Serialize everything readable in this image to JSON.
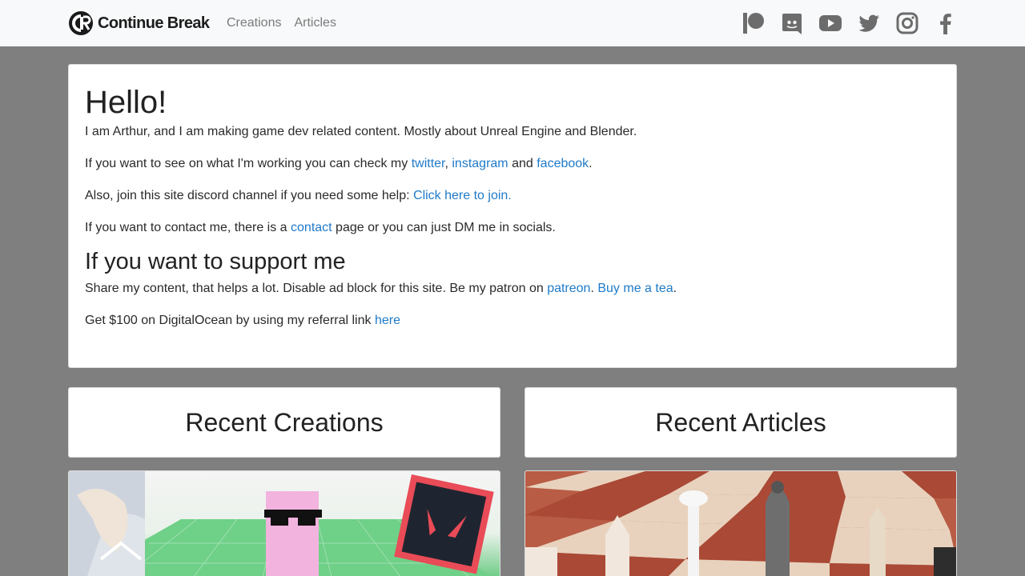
{
  "nav": {
    "brand": "Continue Break",
    "links": [
      "Creations",
      "Articles"
    ],
    "socials": [
      "patreon-icon",
      "discord-icon",
      "youtube-icon",
      "twitter-icon",
      "instagram-icon",
      "facebook-icon"
    ]
  },
  "intro": {
    "title": "Hello!",
    "p1": "I am Arthur, and I am making game dev related content. Mostly about Unreal Engine and Blender.",
    "p2_pre": "If you want to see on what I'm working you can check my ",
    "p2_link1": "twitter",
    "p2_sep": ", ",
    "p2_link2": "instagram",
    "p2_and": " and ",
    "p2_link3": "facebook",
    "p2_end": ".",
    "p3_pre": "Also, join this site discord channel if you need some help: ",
    "p3_link": "Click here to join.",
    "p4_pre": "If you want to contact me, there is a ",
    "p4_link": "contact",
    "p4_post": " page or you can just DM me in socials.",
    "support_title": "If you want to support me",
    "p5_pre": "Share my content, that helps a lot. Disable ad block for this site. Be my patron on ",
    "p5_link1": "patreon",
    "p5_mid": ". ",
    "p5_link2": "Buy me a tea",
    "p5_end": ".",
    "p6_pre": "Get $100 on DigitalOcean by using my referral link ",
    "p6_link": "here"
  },
  "sections": {
    "creations_title": "Recent Creations",
    "articles_title": "Recent Articles"
  },
  "colors": {
    "link": "#1f7ac9",
    "background": "#7f7f7f",
    "navbar": "#f8f9fa"
  }
}
